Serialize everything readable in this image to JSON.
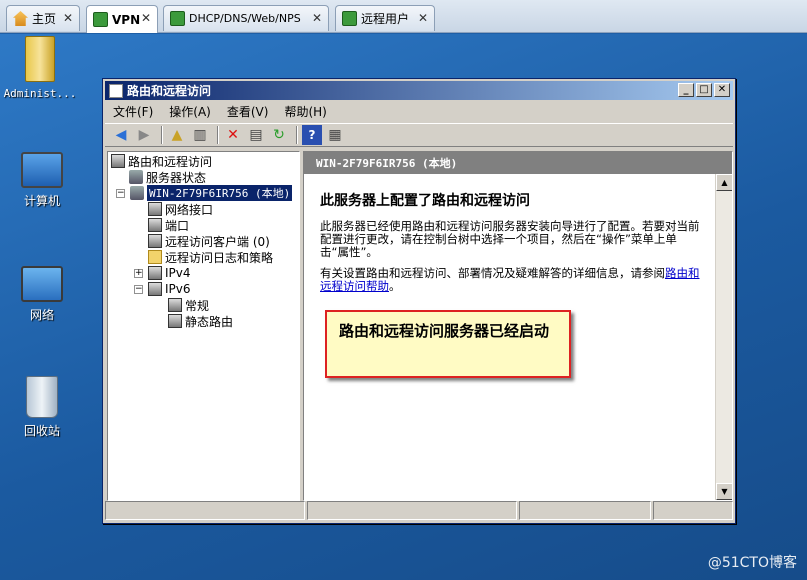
{
  "tabs": [
    {
      "label": "主页",
      "icon": "home-icon"
    },
    {
      "label": "VPN",
      "icon": "vm-icon"
    },
    {
      "label": "DHCP/DNS/Web/NPS",
      "icon": "vm-icon"
    },
    {
      "label": "远程用户",
      "icon": "vm-icon"
    }
  ],
  "desktop_icons": [
    "Administ...",
    "计算机",
    "网络",
    "回收站"
  ],
  "window": {
    "title": "路由和远程访问",
    "menu": [
      "文件(F)",
      "操作(A)",
      "查看(V)",
      "帮助(H)"
    ]
  },
  "tree": {
    "root": "路由和远程访问",
    "server_status": "服务器状态",
    "server": "WIN-2F79F6IR756 (本地)",
    "children": [
      "网络接口",
      "端口",
      "远程访问客户端 (0)",
      "远程访问日志和策略",
      "IPv4",
      "IPv6"
    ],
    "ipv6_children": [
      "常规",
      "静态路由"
    ]
  },
  "right_pane": {
    "header": "WIN-2F79F6IR756 (本地)",
    "title": "此服务器上配置了路由和远程访问",
    "paragraph1": "此服务器已经使用路由和远程访问服务器安装向导进行了配置。若要对当前配置进行更改，请在控制台树中选择一个项目，然后在“操作”菜单上单击“属性”。",
    "paragraph2_prefix": "有关设置路由和远程访问、部署情况及疑难解答的详细信息，请参阅",
    "paragraph2_link": "路由和远程访问帮助",
    "paragraph2_suffix": "。"
  },
  "callout": "路由和远程访问服务器已经启动",
  "watermark": "@51CTO博客"
}
